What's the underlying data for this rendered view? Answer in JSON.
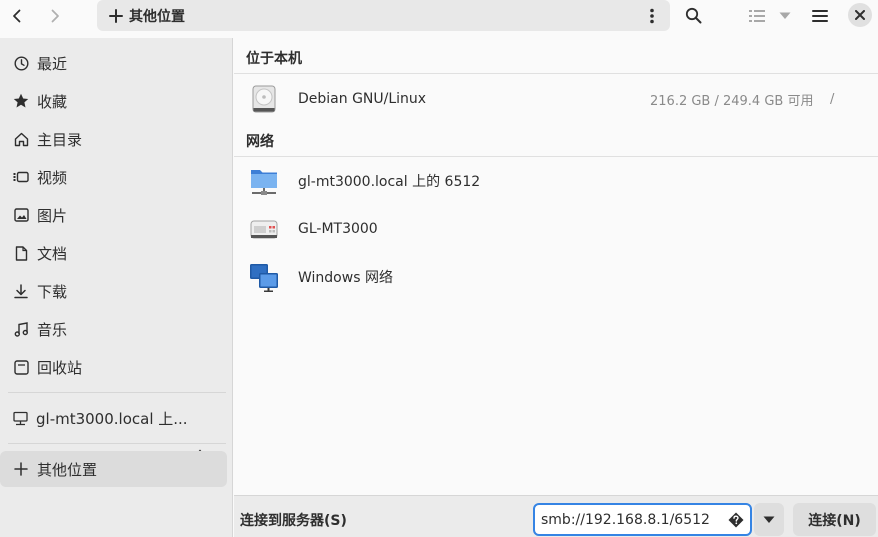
{
  "header": {
    "path_label": "其他位置"
  },
  "sidebar": {
    "items": [
      {
        "label": "最近",
        "icon": "clock-icon"
      },
      {
        "label": "收藏",
        "icon": "star-icon"
      },
      {
        "label": "主目录",
        "icon": "home-icon"
      },
      {
        "label": "视频",
        "icon": "video-icon"
      },
      {
        "label": "图片",
        "icon": "image-icon"
      },
      {
        "label": "文档",
        "icon": "document-icon"
      },
      {
        "label": "下载",
        "icon": "download-icon"
      },
      {
        "label": "音乐",
        "icon": "music-icon"
      },
      {
        "label": "回收站",
        "icon": "trash-icon"
      }
    ],
    "mount": {
      "label": "gl-mt3000.local 上...",
      "icon": "network-share-icon"
    },
    "other_locations": {
      "label": "其他位置",
      "icon": "plus-icon"
    }
  },
  "main": {
    "local_header": "位于本机",
    "local": [
      {
        "name": "Debian GNU/Linux",
        "usage": "216.2 GB / 249.4 GB 可用",
        "mount": "/",
        "icon": "drive-harddisk-icon"
      }
    ],
    "network_header": "网络",
    "network": [
      {
        "name": "gl-mt3000.local 上的 6512",
        "icon": "folder-remote-icon"
      },
      {
        "name": "GL-MT3000",
        "icon": "network-server-icon"
      },
      {
        "name": "Windows 网络",
        "icon": "network-workgroup-icon"
      }
    ]
  },
  "bottom": {
    "label": "连接到服务器(S)",
    "server_value": "smb://192.168.8.1/6512",
    "connect_label": "连接(N)"
  },
  "colors": {
    "accent": "#3584e4",
    "sidebar_bg": "#ebebeb",
    "active_bg": "#dcdcdc"
  }
}
